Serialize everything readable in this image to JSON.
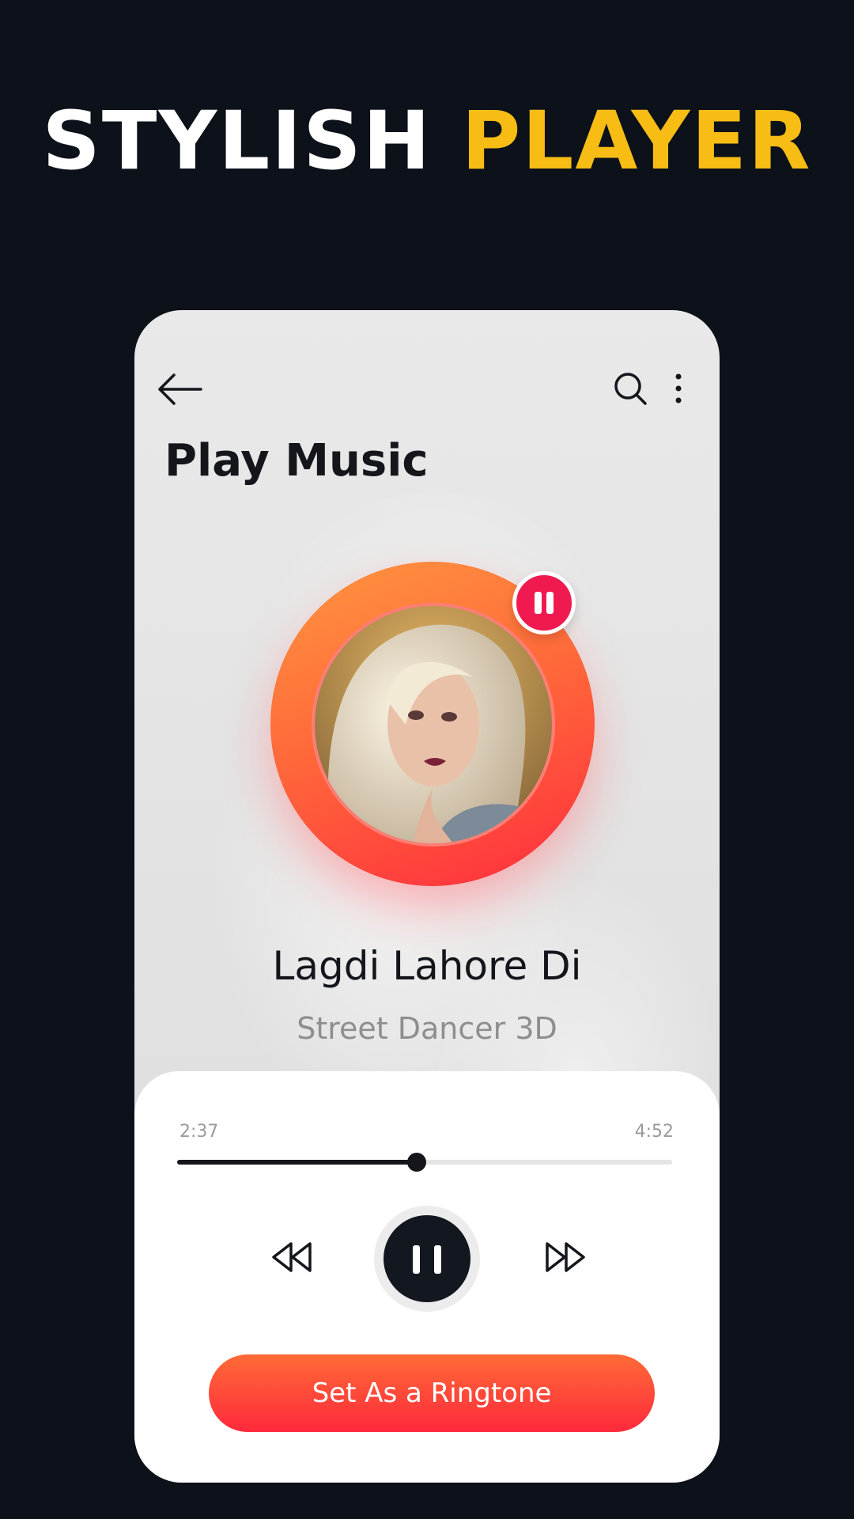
{
  "headline": {
    "white_text": "STYLISH",
    "yellow_text": "PLAYER"
  },
  "topbar": {
    "back_icon": "arrow-left-icon",
    "search_icon": "search-icon",
    "more_icon": "more-vertical-icon"
  },
  "page": {
    "title": "Play Music"
  },
  "now_playing": {
    "song_title": "Lagdi Lahore Di",
    "artist": "Street Dancer 3D",
    "album_art_icon": "album-art-portrait",
    "state_icon": "pause-icon"
  },
  "progress": {
    "elapsed": "2:37",
    "total": "4:52",
    "fraction": 0.484
  },
  "controls": {
    "rewind_icon": "rewind-icon",
    "play_pause_icon": "pause-icon",
    "forward_icon": "fast-forward-icon"
  },
  "actions": {
    "ringtone_label": "Set As a Ringtone"
  },
  "colors": {
    "background": "#0c111a",
    "accent_yellow": "#f7bd14",
    "accent_orange": "#ff7a3c",
    "accent_red": "#ff2d3e",
    "pause_badge": "#f01a50",
    "dark": "#14161c"
  }
}
